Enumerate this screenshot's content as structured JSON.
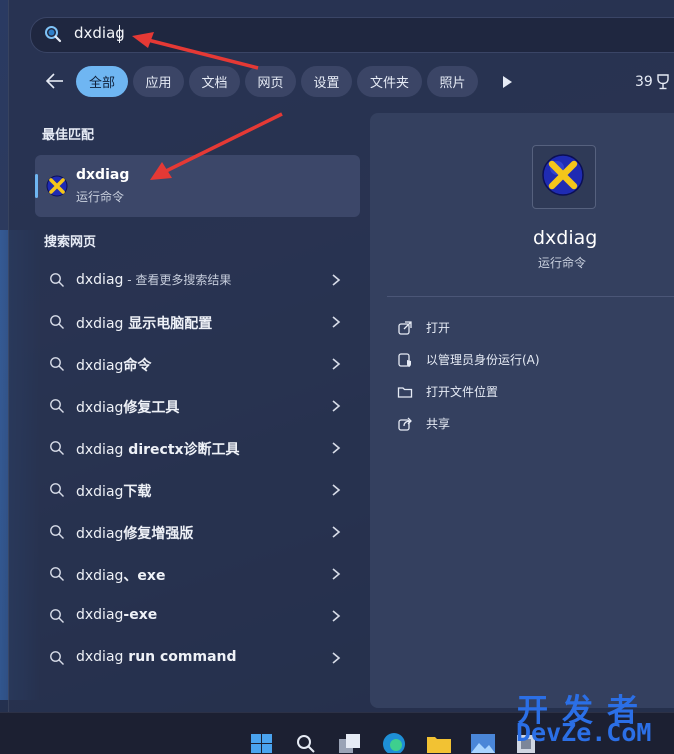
{
  "search": {
    "query": "dxdiag"
  },
  "filters": {
    "chips": [
      "全部",
      "应用",
      "文档",
      "网页",
      "设置",
      "文件夹",
      "照片"
    ],
    "count": "39"
  },
  "best_match": {
    "header": "最佳匹配",
    "title": "dxdiag",
    "subtitle": "运行命令"
  },
  "web": {
    "header": "搜索网页",
    "results": [
      {
        "prefix": "dxdiag",
        "bold": "",
        "gray": " - 查看更多搜索结果"
      },
      {
        "prefix": "dxdiag",
        "bold": " 显示电脑配置",
        "gray": ""
      },
      {
        "prefix": "dxdiag",
        "bold": "命令",
        "gray": ""
      },
      {
        "prefix": "dxdiag",
        "bold": "修复工具",
        "gray": ""
      },
      {
        "prefix": "dxdiag",
        "bold": " directx诊断工具",
        "gray": ""
      },
      {
        "prefix": "dxdiag",
        "bold": "下载",
        "gray": ""
      },
      {
        "prefix": "dxdiag",
        "bold": "修复增强版",
        "gray": ""
      },
      {
        "prefix": "dxdiag",
        "bold": "、exe",
        "gray": ""
      },
      {
        "prefix": "dxdiag",
        "bold": "-exe",
        "gray": ""
      },
      {
        "prefix": "dxdiag",
        "bold": " run command",
        "gray": ""
      }
    ]
  },
  "detail": {
    "title": "dxdiag",
    "subtitle": "运行命令",
    "actions": [
      "打开",
      "以管理员身份运行(A)",
      "打开文件位置",
      "共享"
    ]
  },
  "watermark": {
    "line1": "开发者",
    "line2": "DevZe.CoM"
  },
  "colors": {
    "accent": "#6fb6f2",
    "arrow": "#e53935",
    "watermark": "#2b6fe6"
  }
}
